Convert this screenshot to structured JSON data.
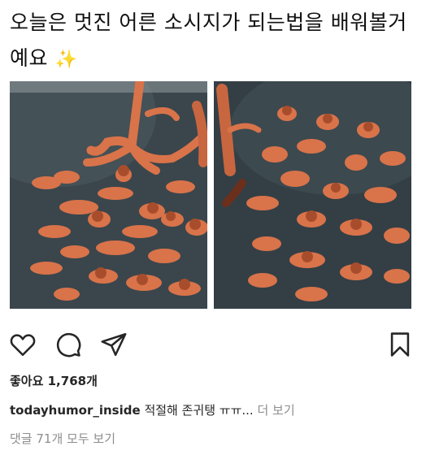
{
  "post": {
    "caption_text": "오늘은 멋진 어른 소시지가 되는법을 배워볼거예요",
    "caption_emoji": "✨",
    "image_left_alt": "",
    "image_right_alt": "",
    "likes_text": "좋아요 1,768개",
    "comment": {
      "username": "todayhumor_inside",
      "text": "적절해 존귀탱 ㅠㅠ...",
      "more_label": "더 보기"
    },
    "view_comments_label": "댓글 71개 모두 보기"
  },
  "icons": {
    "like": "heart-icon",
    "comment": "comment-icon",
    "share": "paper-plane-icon",
    "save": "bookmark-icon"
  },
  "colors": {
    "text": "#262626",
    "muted": "#8e8e8e",
    "pan": "#2e3a40",
    "sausage": "#d9734a"
  }
}
